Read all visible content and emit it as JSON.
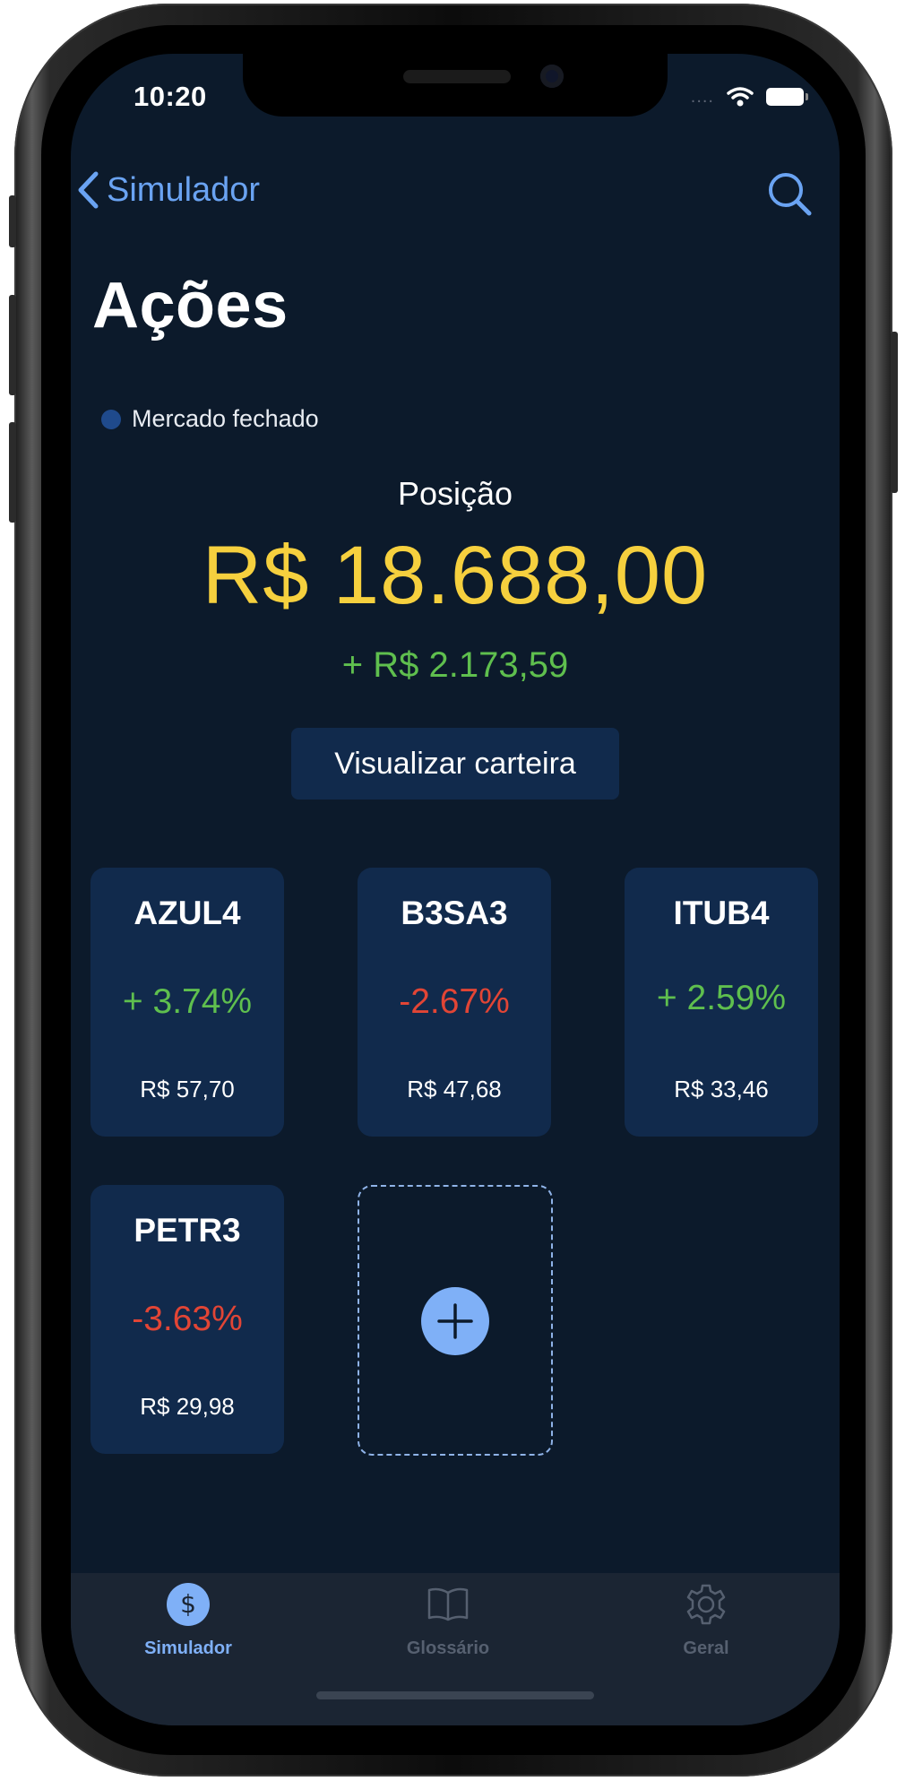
{
  "status_bar": {
    "time": "10:20",
    "signal": "....",
    "wifi_icon": "wifi-icon",
    "battery_icon": "battery-icon"
  },
  "nav": {
    "back_label": "Simulador",
    "back_icon": "chevron-left-icon",
    "search_icon": "search-icon",
    "accent": "#6aa3f2"
  },
  "page": {
    "title": "Ações",
    "market_status": "Mercado fechado"
  },
  "summary": {
    "label": "Posição",
    "value": "R$ 18.688,00",
    "change": "+ R$ 2.173,59",
    "value_color": "#f6d03e",
    "up_color": "#5fbf4e",
    "down_color": "#e24535"
  },
  "portfolio_button": "Visualizar carteira",
  "stocks": [
    {
      "ticker": "AZUL4",
      "change": "+ 3.74%",
      "direction": "up",
      "price": "R$ 57,70"
    },
    {
      "ticker": "B3SA3",
      "change": "-2.67%",
      "direction": "down",
      "price": "R$ 47,68"
    },
    {
      "ticker": "ITUB4",
      "change": "+ 2.59%",
      "direction": "up",
      "price": "R$ 33,46"
    },
    {
      "ticker": "PETR3",
      "change": "-3.63%",
      "direction": "down",
      "price": "R$ 29,98"
    }
  ],
  "add_stock_icon": "plus-icon",
  "tabs": [
    {
      "label": "Simulador",
      "icon": "dollar-icon",
      "active": true
    },
    {
      "label": "Glossário",
      "icon": "book-icon",
      "active": false
    },
    {
      "label": "Geral",
      "icon": "gear-icon",
      "active": false
    }
  ]
}
